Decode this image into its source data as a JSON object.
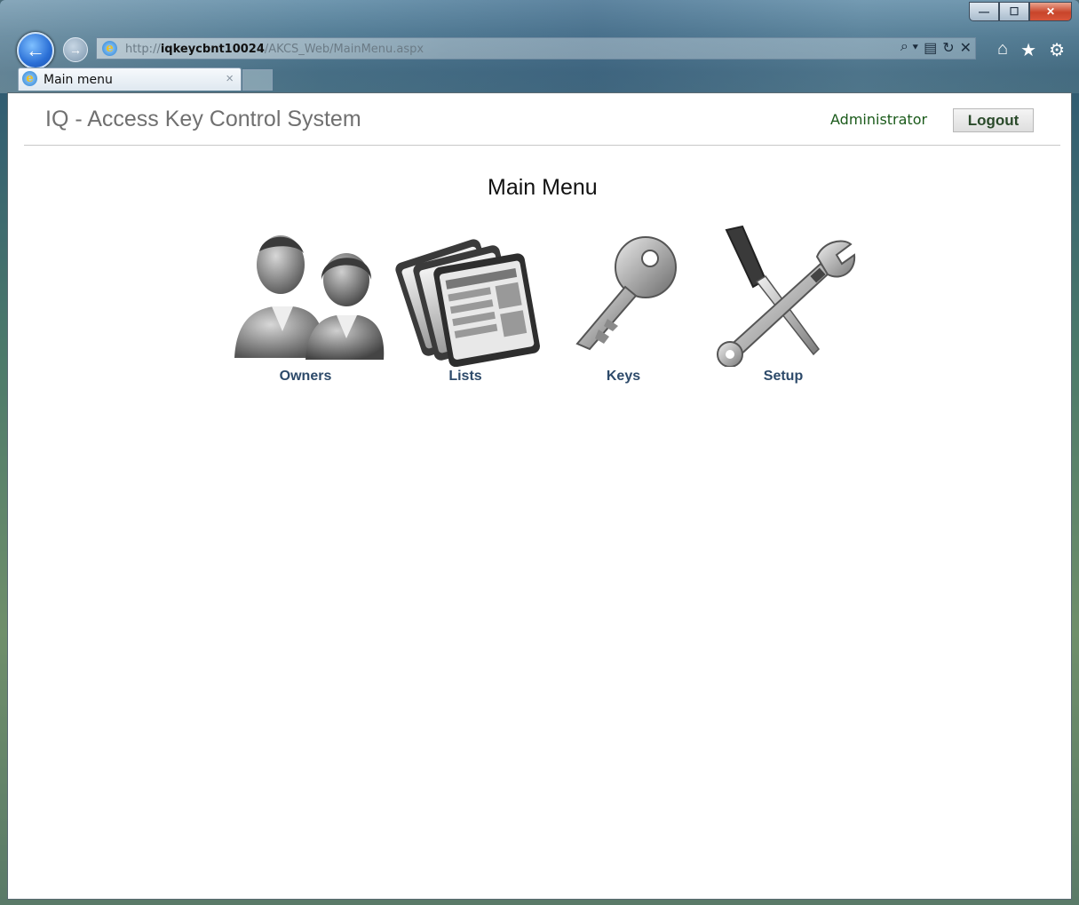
{
  "browser": {
    "url_prefix": "http://",
    "url_host": "iqkeycbnt10024",
    "url_path": "/AKCS_Web/MainMenu.aspx",
    "tab_title": "Main menu",
    "tab_close": "×",
    "search_glyph": "⌕ ▾",
    "compat_glyph": "▤",
    "refresh_glyph": "↻",
    "stop_glyph": "✕"
  },
  "header": {
    "app_title": "IQ - Access Key Control System",
    "user": "Administrator",
    "logout_label": "Logout"
  },
  "main": {
    "title": "Main Menu",
    "tiles": [
      {
        "label": "Owners",
        "icon": "people-icon"
      },
      {
        "label": "Lists",
        "icon": "lists-icon"
      },
      {
        "label": "Keys",
        "icon": "key-icon"
      },
      {
        "label": "Setup",
        "icon": "tools-icon"
      }
    ]
  },
  "colors": {
    "accent_link": "#2d4a6a",
    "user_text": "#1a5a1a",
    "title_text": "#707070"
  }
}
